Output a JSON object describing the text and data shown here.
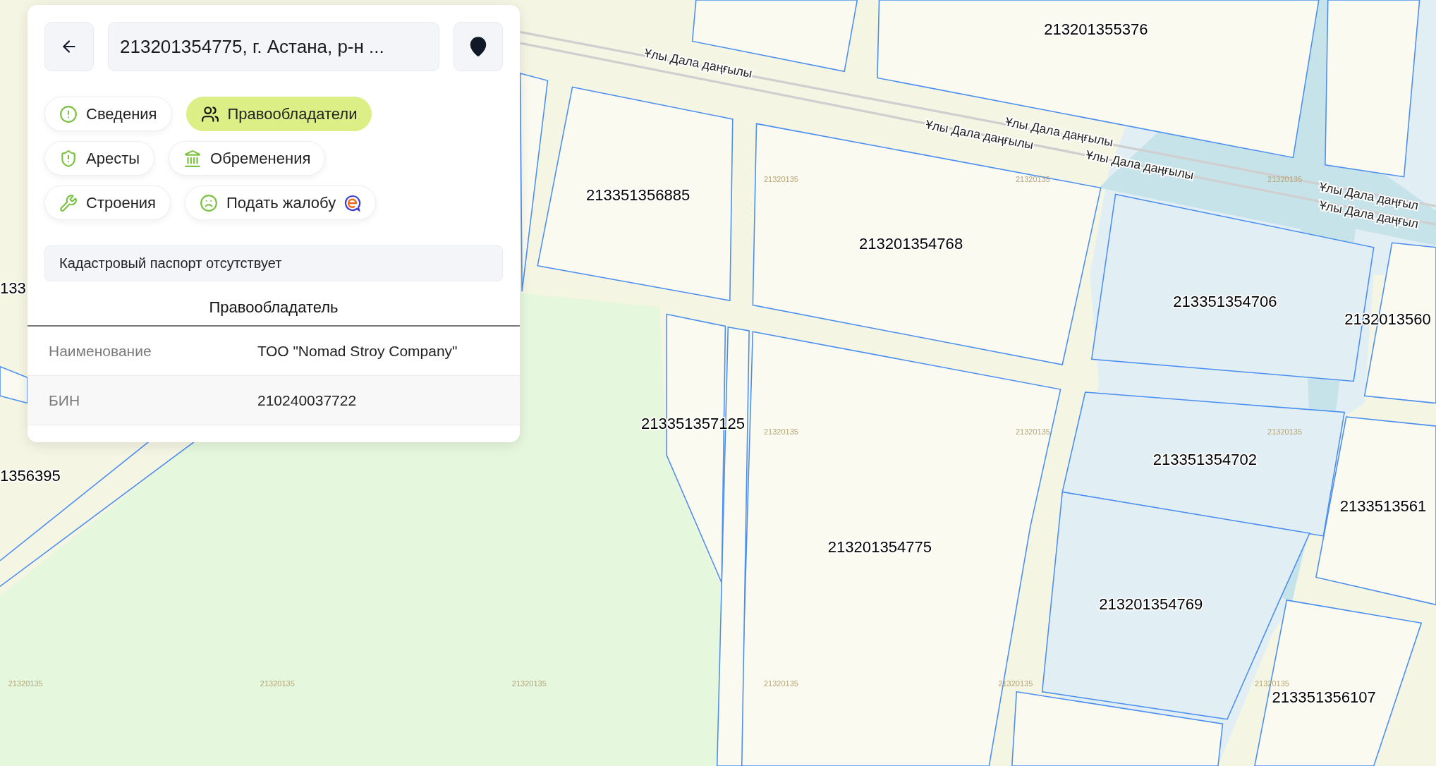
{
  "header": {
    "search_value": "213201354775, г. Астана, р-н ..."
  },
  "tabs": [
    {
      "label": "Сведения",
      "selected": false,
      "logo": false
    },
    {
      "label": "Правообладатели",
      "selected": true,
      "logo": false
    },
    {
      "label": "Аресты",
      "selected": false,
      "logo": false
    },
    {
      "label": "Обременения",
      "selected": false,
      "logo": false
    },
    {
      "label": "Строения",
      "selected": false,
      "logo": false
    },
    {
      "label": "Подать жалобу",
      "selected": false,
      "logo": true
    }
  ],
  "notice": "Кадастровый паспорт отсутствует",
  "section_title": "Правообладатель",
  "table": {
    "rows": [
      {
        "label": "Наименование",
        "value": "ТОО \"Nomad Stroy Company\""
      },
      {
        "label": "БИН",
        "value": "210240037722"
      }
    ]
  },
  "map": {
    "parcel_labels": [
      "213201355376",
      "213351356885",
      "213201354768",
      "213351354706",
      "2132013560",
      "133",
      "213351357125",
      "1356395",
      "213351354702",
      "2133513561",
      "213201354775",
      "213201354769",
      "213351356107"
    ],
    "road_labels": [
      "Ұлы Дала даңғылы",
      "Ұлы Дала даңғылы",
      "Ұлы Дала даңғылы",
      "Ұлы Дала даңғылы",
      "Ұлы Дала даңғыл",
      "Ұлы Дала даңғыл"
    ],
    "block_labels": [
      "21320135",
      "21320135",
      "21320135",
      "21320135",
      "21320135",
      "21320135",
      "21320135",
      "21320135",
      "21320135",
      "21320135",
      "21320135",
      "21320135"
    ]
  }
}
